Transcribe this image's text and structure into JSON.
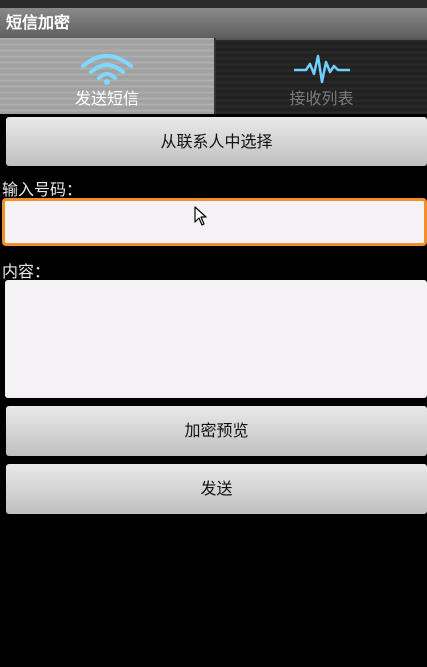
{
  "app": {
    "title": "短信加密"
  },
  "tabs": [
    {
      "label": "发送短信",
      "icon": "wifi-signal-icon",
      "active": true
    },
    {
      "label": "接收列表",
      "icon": "waveform-icon",
      "active": false
    }
  ],
  "form": {
    "contacts_button": "从联系人中选择",
    "number_label": "输入号码：",
    "number_value": "",
    "content_label": "内容：",
    "content_value": "",
    "preview_button": "加密预览",
    "send_button": "发送"
  },
  "colors": {
    "focus_border": "#f0902a",
    "tab_icon": "#6fd0ff"
  }
}
